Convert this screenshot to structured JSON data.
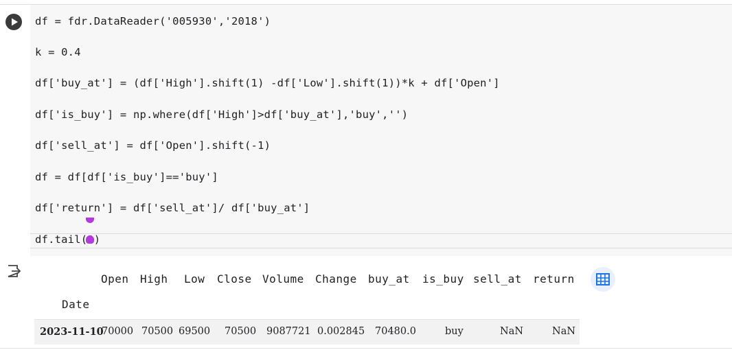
{
  "cell": {
    "code_lines": [
      "df = fdr.DataReader('005930','2018')",
      "k = 0.4",
      "df['buy_at'] = (df['High'].shift(1) -df['Low'].shift(1))*k + df['Open']",
      "df['is_buy'] = np.where(df['High']>df['buy_at'],'buy','')",
      "df['sell_at'] = df['Open'].shift(-1)",
      "df = df[df['is_buy']=='buy']",
      "df['return'] = df['sell_at']/ df['buy_at']",
      "df.tail(1)"
    ]
  },
  "output": {
    "columns": [
      "Open",
      "High",
      "Low",
      "Close",
      "Volume",
      "Change",
      "buy_at",
      "is_buy",
      "sell_at",
      "return"
    ],
    "index_name": "Date",
    "rows": [
      {
        "date": "2023-11-10",
        "values": [
          "70000",
          "70500",
          "69500",
          "70500",
          "9087721",
          "0.002845",
          "70480.0",
          "buy",
          "NaN",
          "NaN"
        ]
      }
    ]
  },
  "icons": {
    "run": "play-icon",
    "output": "output-redirect-icon",
    "table": "table-icon"
  },
  "colors": {
    "string": "#b5331f",
    "number": "#1a7f5a",
    "bracket": "#1c3aa9",
    "accent": "#1a73e8"
  }
}
